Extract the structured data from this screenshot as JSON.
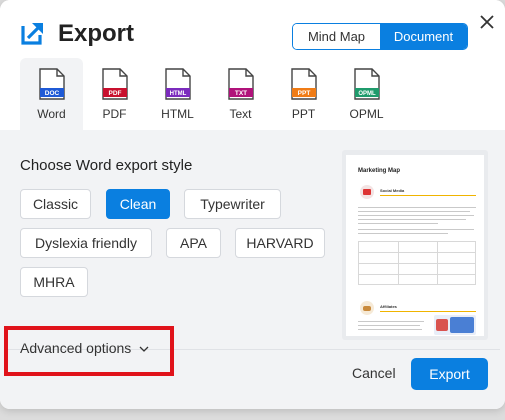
{
  "title": "Export",
  "mode_toggle": {
    "mind_map": "Mind Map",
    "document": "Document",
    "selected": "Document"
  },
  "formats": [
    {
      "tag": "DOC",
      "label": "Word",
      "color": "#1f5ad6",
      "active": true
    },
    {
      "tag": "PDF",
      "label": "PDF",
      "color": "#c8102e",
      "active": false
    },
    {
      "tag": "HTML",
      "label": "HTML",
      "color": "#7b2bbd",
      "active": false
    },
    {
      "tag": "TXT",
      "label": "Text",
      "color": "#b0127a",
      "active": false
    },
    {
      "tag": "PPT",
      "label": "PPT",
      "color": "#f07c16",
      "active": false
    },
    {
      "tag": "OPML",
      "label": "OPML",
      "color": "#1f9b6c",
      "active": false
    }
  ],
  "style_heading": "Choose Word export style",
  "styles": {
    "classic": "Classic",
    "clean": "Clean",
    "typewriter": "Typewriter",
    "dyslexia": "Dyslexia friendly",
    "apa": "APA",
    "harvard": "HARVARD",
    "mhra": "MHRA",
    "selected": "Clean"
  },
  "preview": {
    "page_title": "Marketing Map",
    "section1": "Social Media",
    "section2": "Affiliates"
  },
  "advanced_options": "Advanced options",
  "cancel": "Cancel",
  "export": "Export",
  "colors": {
    "accent": "#0a7fe0",
    "highlight": "#e0121a"
  }
}
